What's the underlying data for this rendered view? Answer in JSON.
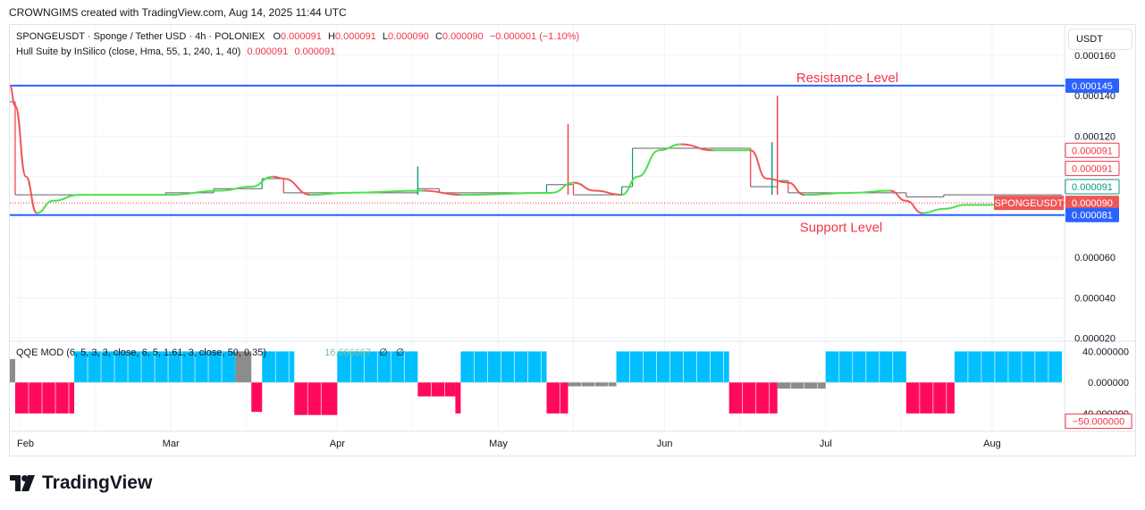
{
  "watermark": "CROWNGIMS created with TradingView.com, Aug 14, 2025 11:44 UTC",
  "legend": {
    "symbol": "SPONGEUSDT · Sponge / Tether USD · 4h · POLONIEX",
    "o_label": "O",
    "o": "0.000091",
    "h_label": "H",
    "h": "0.000091",
    "l_label": "L",
    "l": "0.000090",
    "c_label": "C",
    "c": "0.000090",
    "change": "−0.000001 (−1.10%)",
    "hull_label": "Hull Suite by InSilico (close, Hma, 55, 1, 240, 1, 40)",
    "hull_v1": "0.000091",
    "hull_v2": "0.000091",
    "qqe_label": "QQE MOD (6, 5, 3, 3, close, 6, 5, 1.61, 3, close, 50, 0.35)",
    "qqe_value": "16.666667",
    "qqe_na1": "∅",
    "qqe_na2": "∅"
  },
  "currency": "USDT",
  "brand": "TradingView",
  "colors": {
    "up": "#089981",
    "down": "#f23645",
    "hull_up": "#4ce04c",
    "hull_down": "#f05656",
    "level": "#2962ff",
    "qqe_blue": "#00bfff",
    "qqe_pink": "#ff0a5a",
    "qqe_gray": "#8c8c8c"
  },
  "chart_data": {
    "type": "candlestick",
    "timeframe": "4h",
    "x_labels": [
      "Feb",
      "Mar",
      "Apr",
      "May",
      "Jun",
      "Jul",
      "Aug"
    ],
    "y_ticks": [
      "0.000160",
      "0.000140",
      "0.000120",
      "0.000060",
      "0.000040",
      "0.000020"
    ],
    "ylim": [
      1.9e-05,
      0.000175
    ],
    "price_segments": [
      {
        "from": "2025-01-30",
        "to": "2025-01-31",
        "value": 0.000137
      },
      {
        "from": "2025-01-31",
        "to": "2025-02-09",
        "value": 9.1e-05
      },
      {
        "from": "2025-02-09",
        "to": "2025-02-28",
        "value": 9.1e-05
      },
      {
        "from": "2025-02-28",
        "to": "2025-03-09",
        "value": 9.2e-05
      },
      {
        "from": "2025-03-09",
        "to": "2025-03-18",
        "value": 9.4e-05
      },
      {
        "from": "2025-03-18",
        "to": "2025-03-22",
        "value": 9.9e-05
      },
      {
        "from": "2025-03-22",
        "to": "2025-04-01",
        "value": 9.2e-05
      },
      {
        "from": "2025-04-01",
        "to": "2025-04-16",
        "value": 9.2e-05
      },
      {
        "from": "2025-04-16",
        "to": "2025-04-20",
        "value": 9.4e-05
      },
      {
        "from": "2025-04-20",
        "to": "2025-05-10",
        "value": 9.2e-05
      },
      {
        "from": "2025-05-10",
        "to": "2025-05-15",
        "value": 9.6e-05
      },
      {
        "from": "2025-05-15",
        "to": "2025-05-24",
        "value": 9.1e-05
      },
      {
        "from": "2025-05-24",
        "to": "2025-05-26",
        "value": 9.5e-05
      },
      {
        "from": "2025-05-26",
        "to": "2025-06-17",
        "value": 0.000114
      },
      {
        "from": "2025-06-17",
        "to": "2025-06-22",
        "value": 9.5e-05
      },
      {
        "from": "2025-06-22",
        "to": "2025-06-24",
        "value": 9.8e-05
      },
      {
        "from": "2025-06-24",
        "to": "2025-07-13",
        "value": 9.2e-05
      },
      {
        "from": "2025-07-13",
        "to": "2025-07-16",
        "value": 9.2e-05
      },
      {
        "from": "2025-07-16",
        "to": "2025-07-23",
        "value": 9e-05
      },
      {
        "from": "2025-07-23",
        "to": "2025-08-14",
        "value": 9.1e-05
      }
    ],
    "spikes": [
      {
        "date": "2025-04-16",
        "high": 0.000105,
        "low": 9.1e-05
      },
      {
        "date": "2025-05-14",
        "high": 0.000126,
        "low": 9.1e-05
      },
      {
        "date": "2025-06-22",
        "high": 0.00014,
        "low": 9.1e-05
      },
      {
        "date": "2025-06-21",
        "high": 0.000117,
        "low": 9.1e-05
      }
    ],
    "hull": [
      {
        "date": "2025-01-30",
        "value": 0.000145
      },
      {
        "date": "2025-01-31",
        "value": 0.000135
      },
      {
        "date": "2025-02-02",
        "value": 0.0001
      },
      {
        "date": "2025-02-04",
        "value": 8.2e-05
      },
      {
        "date": "2025-02-07",
        "value": 8.8e-05
      },
      {
        "date": "2025-02-12",
        "value": 9.1e-05
      },
      {
        "date": "2025-03-01",
        "value": 9.1e-05
      },
      {
        "date": "2025-03-10",
        "value": 9.3e-05
      },
      {
        "date": "2025-03-16",
        "value": 9.5e-05
      },
      {
        "date": "2025-03-20",
        "value": 0.0001
      },
      {
        "date": "2025-03-22",
        "value": 9.9e-05
      },
      {
        "date": "2025-03-27",
        "value": 9.1e-05
      },
      {
        "date": "2025-04-03",
        "value": 9.2e-05
      },
      {
        "date": "2025-04-17",
        "value": 9.3e-05
      },
      {
        "date": "2025-04-24",
        "value": 9.1e-05
      },
      {
        "date": "2025-05-11",
        "value": 9.2e-05
      },
      {
        "date": "2025-05-15",
        "value": 9.7e-05
      },
      {
        "date": "2025-05-19",
        "value": 9.3e-05
      },
      {
        "date": "2025-05-24",
        "value": 9.1e-05
      },
      {
        "date": "2025-05-27",
        "value": 0.0001
      },
      {
        "date": "2025-05-31",
        "value": 0.000113
      },
      {
        "date": "2025-06-04",
        "value": 0.000116
      },
      {
        "date": "2025-06-10",
        "value": 0.000113
      },
      {
        "date": "2025-06-17",
        "value": 0.000113
      },
      {
        "date": "2025-06-20",
        "value": 9.9e-05
      },
      {
        "date": "2025-06-24",
        "value": 9.7e-05
      },
      {
        "date": "2025-06-27",
        "value": 9.1e-05
      },
      {
        "date": "2025-07-06",
        "value": 9.2e-05
      },
      {
        "date": "2025-07-13",
        "value": 9.3e-05
      },
      {
        "date": "2025-07-16",
        "value": 8.8e-05
      },
      {
        "date": "2025-07-19",
        "value": 8.2e-05
      },
      {
        "date": "2025-07-23",
        "value": 8.4e-05
      },
      {
        "date": "2025-07-27",
        "value": 8.6e-05
      },
      {
        "date": "2025-08-14",
        "value": 8.6e-05
      }
    ],
    "levels": [
      {
        "name": "Resistance Level",
        "value": 0.000145
      },
      {
        "name": "Support Level",
        "value": 8.1e-05
      }
    ],
    "price_labels": [
      {
        "text": "0.000145",
        "value": 0.000145,
        "style": "blue"
      },
      {
        "text": "0.000091",
        "value": 0.000113,
        "style": "red-outline"
      },
      {
        "text": "0.000091",
        "value": 0.000104,
        "style": "red-outline"
      },
      {
        "text": "0.000091",
        "value": 9.5e-05,
        "style": "green-outline"
      },
      {
        "text": "0.000090",
        "value": 8.7e-05,
        "style": "red",
        "tag": "SPONGEUSDT"
      },
      {
        "text": "0.000081",
        "value": 8.1e-05,
        "style": "blue"
      }
    ],
    "qqe": {
      "y_ticks": [
        "40.000000",
        "0.000000",
        "-40.000000"
      ],
      "last_label": "−50.000000",
      "ylim": [
        -62,
        52
      ],
      "blocks": [
        {
          "from": "2025-01-30",
          "to": "2025-01-31",
          "value": 30,
          "color": "gray"
        },
        {
          "from": "2025-01-31",
          "to": "2025-02-11",
          "value": -40,
          "color": "pink"
        },
        {
          "from": "2025-02-11",
          "to": "2025-03-13",
          "value": 40,
          "color": "blue"
        },
        {
          "from": "2025-03-13",
          "to": "2025-03-16",
          "value": 40,
          "color": "gray"
        },
        {
          "from": "2025-03-16",
          "to": "2025-03-18",
          "value": -38,
          "color": "pink"
        },
        {
          "from": "2025-03-18",
          "to": "2025-03-24",
          "value": 40,
          "color": "blue"
        },
        {
          "from": "2025-03-24",
          "to": "2025-04-01",
          "value": -42,
          "color": "pink"
        },
        {
          "from": "2025-04-01",
          "to": "2025-04-16",
          "value": 40,
          "color": "blue"
        },
        {
          "from": "2025-04-16",
          "to": "2025-04-23",
          "value": -18,
          "color": "pink"
        },
        {
          "from": "2025-04-23",
          "to": "2025-04-24",
          "value": -40,
          "color": "pink"
        },
        {
          "from": "2025-04-24",
          "to": "2025-05-10",
          "value": 40,
          "color": "blue"
        },
        {
          "from": "2025-05-10",
          "to": "2025-05-14",
          "value": -40,
          "color": "pink"
        },
        {
          "from": "2025-05-14",
          "to": "2025-05-23",
          "value": -5,
          "color": "gray"
        },
        {
          "from": "2025-05-23",
          "to": "2025-06-13",
          "value": 40,
          "color": "blue"
        },
        {
          "from": "2025-06-13",
          "to": "2025-06-22",
          "value": -40,
          "color": "pink"
        },
        {
          "from": "2025-06-22",
          "to": "2025-07-01",
          "value": -8,
          "color": "gray"
        },
        {
          "from": "2025-07-01",
          "to": "2025-07-16",
          "value": 40,
          "color": "blue"
        },
        {
          "from": "2025-07-16",
          "to": "2025-07-25",
          "value": -40,
          "color": "pink"
        },
        {
          "from": "2025-07-25",
          "to": "2025-08-14",
          "value": 40,
          "color": "blue"
        }
      ]
    }
  }
}
